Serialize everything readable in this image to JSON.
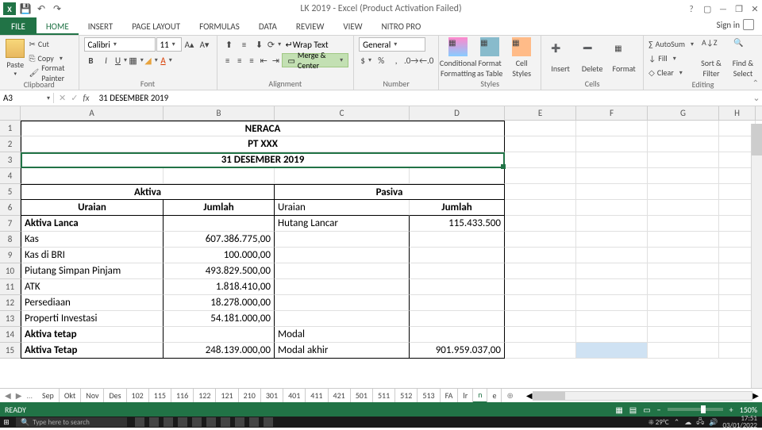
{
  "title": "LK 2019 - Excel (Product Activation Failed)",
  "signin": "Sign in",
  "tabs": [
    "FILE",
    "HOME",
    "INSERT",
    "PAGE LAYOUT",
    "FORMULAS",
    "DATA",
    "REVIEW",
    "VIEW",
    "NITRO PRO"
  ],
  "ribbon": {
    "clipboard": {
      "paste": "Paste",
      "cut": "Cut",
      "copy": "Copy",
      "fp": "Format Painter",
      "label": "Clipboard"
    },
    "font": {
      "name": "Calibri",
      "size": "11",
      "label": "Font"
    },
    "alignment": {
      "wrap": "Wrap Text",
      "merge": "Merge & Center",
      "label": "Alignment"
    },
    "number": {
      "format": "General",
      "label": "Number"
    },
    "styles": {
      "cond": "Conditional Formatting",
      "fmt": "Format as Table",
      "cell": "Cell Styles",
      "label": "Styles"
    },
    "cells": {
      "ins": "Insert",
      "del": "Delete",
      "fmt": "Format",
      "label": "Cells"
    },
    "editing": {
      "sum": "AutoSum",
      "fill": "Fill",
      "clear": "Clear",
      "sort": "Sort & Filter",
      "find": "Find & Select",
      "label": "Editing"
    }
  },
  "namebox": "A3",
  "formula": "31 DESEMBER 2019",
  "cols": [
    "A",
    "B",
    "C",
    "D",
    "E",
    "F",
    "G",
    "H"
  ],
  "rows": {
    "1": {
      "merged": "NERACA"
    },
    "2": {
      "merged": "PT XXX"
    },
    "3": {
      "merged": "31 DESEMBER 2019"
    },
    "5": {
      "aktiva": "Aktiva",
      "pasiva": "Pasiva"
    },
    "6": {
      "a": "Uraian",
      "b": "Jumlah",
      "c": "Uraian",
      "d": "Jumlah"
    },
    "7": {
      "a": "Aktiva Lanca",
      "c": "Hutang Lancar",
      "d": "115.433.500"
    },
    "8": {
      "a": "Kas",
      "b": "607.386.775,00"
    },
    "9": {
      "a": "Kas di BRI",
      "b": "100.000,00"
    },
    "10": {
      "a": "Piutang Simpan Pinjam",
      "b": "493.829.500,00"
    },
    "11": {
      "a": "ATK",
      "b": "1.818.410,00"
    },
    "12": {
      "a": "Persediaan",
      "b": "18.278.000,00"
    },
    "13": {
      "a": "Properti Investasi",
      "b": "54.181.000,00"
    },
    "14": {
      "a": "Aktiva tetap",
      "c": "Modal"
    },
    "15": {
      "a": "Aktiva Tetap",
      "b": "248.139.000,00",
      "c": "Modal akhir",
      "d": "901.959.037,00"
    }
  },
  "sheet_tabs": [
    "Sep",
    "Okt",
    "Nov",
    "Des",
    "102",
    "115",
    "116",
    "122",
    "121",
    "210",
    "301",
    "401",
    "411",
    "421",
    "501",
    "511",
    "512",
    "513",
    "FA",
    "lr",
    "n",
    "e"
  ],
  "active_sheet": "n",
  "status": "READY",
  "zoom": "150%",
  "weather": "29°C",
  "clock": {
    "time": "17:51",
    "date": "03/01/2022"
  },
  "search_ph": "Type here to search"
}
